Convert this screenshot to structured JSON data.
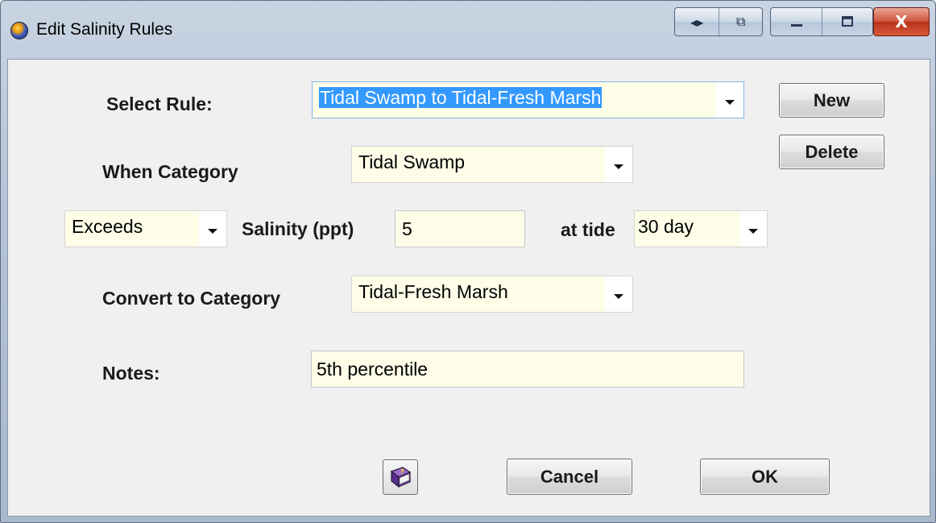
{
  "window": {
    "title": "Edit Salinity Rules",
    "controls": {
      "nav_icon": "◂▸",
      "pin_icon": "⧉",
      "minimize_icon": "—",
      "maximize_icon": "▢",
      "close_icon": "X"
    }
  },
  "form": {
    "select_rule": {
      "label": "Select Rule:",
      "value": "Tidal Swamp to Tidal-Fresh Marsh"
    },
    "when_category": {
      "label": "When Category",
      "value": "Tidal Swamp"
    },
    "condition": {
      "comparator": "Exceeds",
      "salinity_label": "Salinity (ppt)",
      "salinity_value": "5",
      "tide_label": "at tide",
      "tide_value": "30 day"
    },
    "convert_to": {
      "label": "Convert to Category",
      "value": "Tidal-Fresh Marsh"
    },
    "notes": {
      "label": "Notes:",
      "value": "5th percentile"
    }
  },
  "buttons": {
    "new": "New",
    "delete": "Delete",
    "cancel": "Cancel",
    "ok": "OK",
    "help_icon": "help-book-icon"
  },
  "colors": {
    "field_bg": "#fdfde8",
    "selection": "#3399ff",
    "dialog_bg": "#f0f0f0"
  }
}
